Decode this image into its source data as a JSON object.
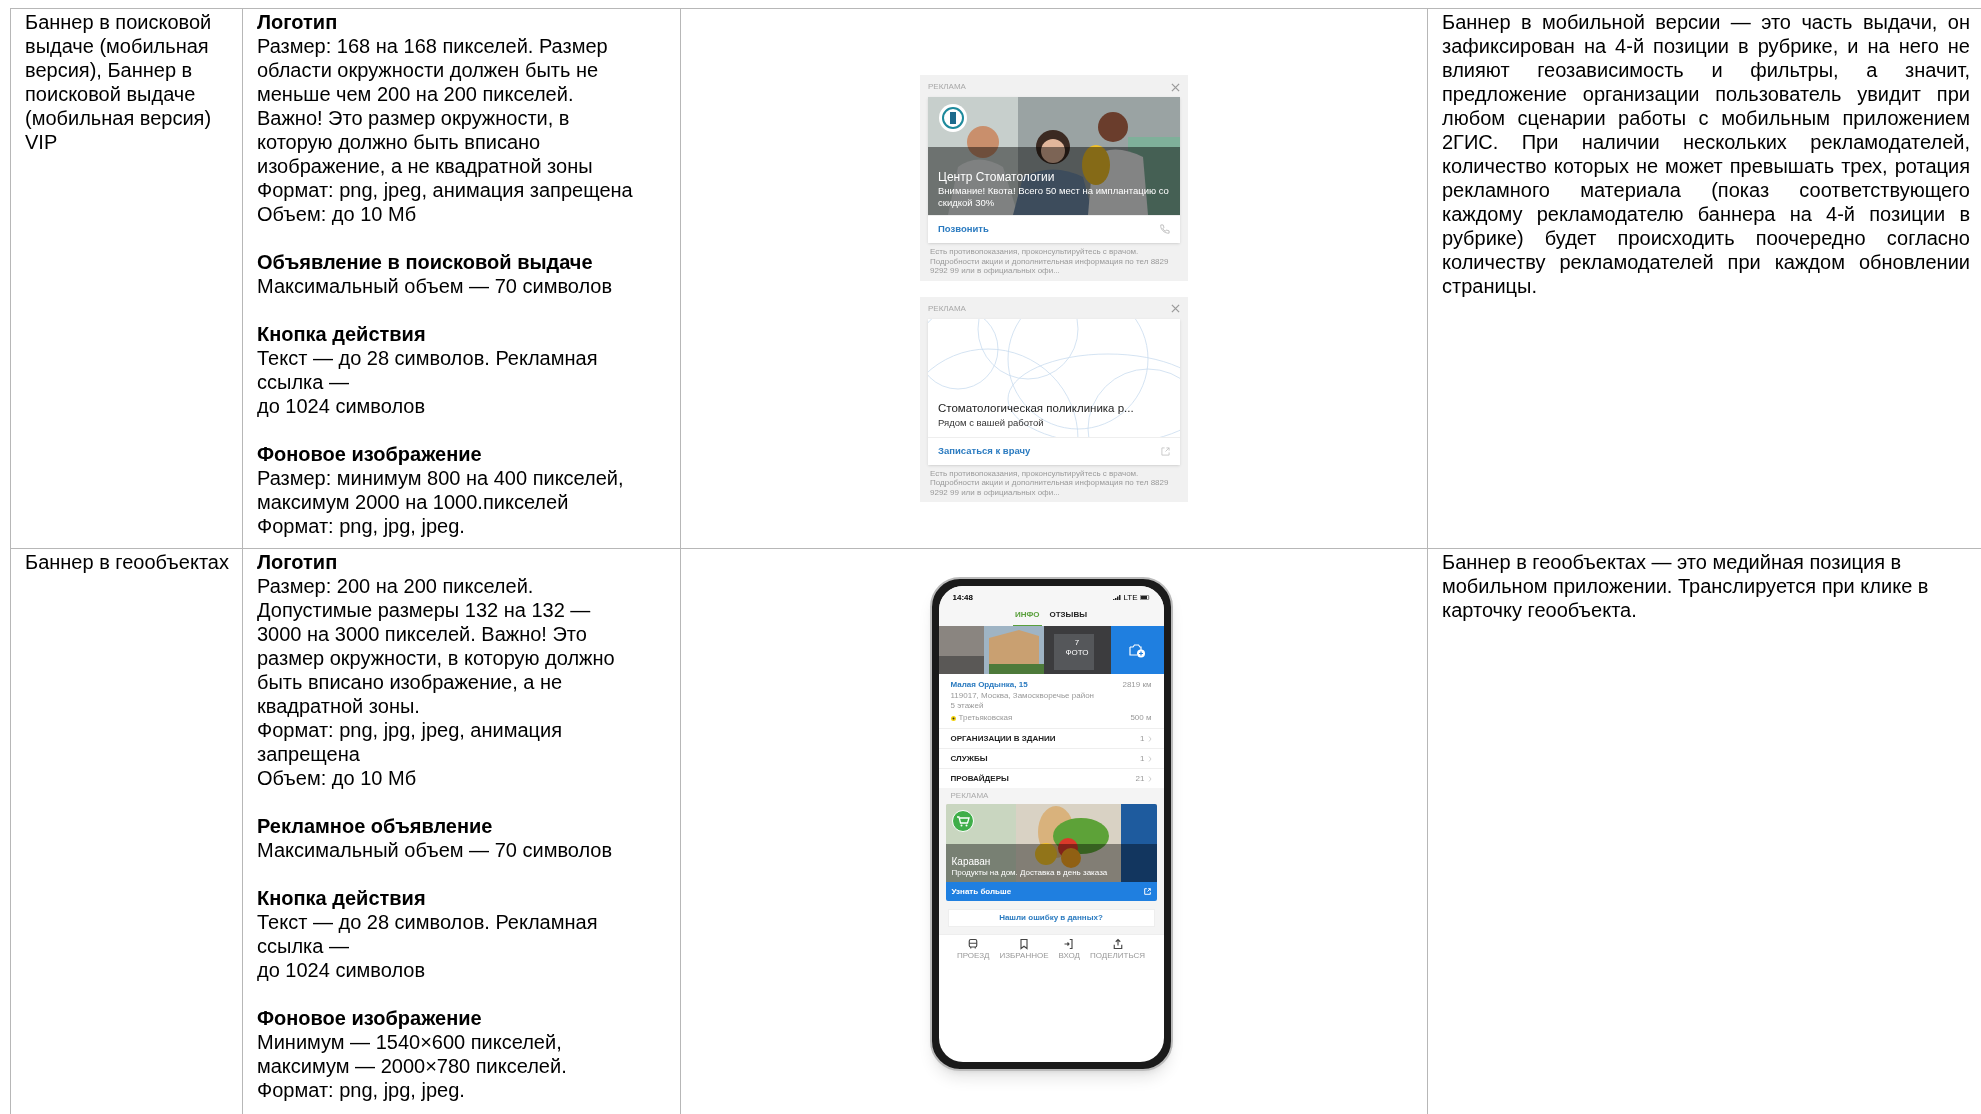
{
  "table": {
    "rows": [
      {
        "name": "Баннер в поисковой выдаче (мобильная версия), Баннер в поисковой выдаче (мобильная версия) VIP",
        "requirements": [
          {
            "heading": "Логотип",
            "lines": [
              "Размер: 168 на 168 пикселей. Размер области окружности должен быть не меньше чем 200 на 200 пикселей. Важно! Это размер окружности, в которую должно быть вписано изображение, а не квадратной зоны",
              "Формат: png, jpeg, анимация запрещена",
              "Объем: до 10 Мб"
            ]
          },
          {
            "heading": "Объявление в поисковой выдаче",
            "lines": [
              "Максимальный объем — 70 символов"
            ]
          },
          {
            "heading": "Кнопка действия",
            "lines": [
              "Текст — до 28 символов. Рекламная ссылка —",
              "до 1024 символов"
            ]
          },
          {
            "heading": "Фоновое изображение",
            "lines": [
              "Размер: минимум 800 на 400 пикселей, максимум 2000 на 1000.пикселей",
              "Формат: png, jpg, jpeg."
            ]
          }
        ],
        "preview": {
          "kind": "banners",
          "banners": [
            {
              "label": "РЕКЛАМА",
              "title": "Центр Стоматологии",
              "text": "Внимание! Квота! Всего 50 мест на имплантацию со скидкой 30%",
              "action": "Позвонить",
              "disclaimer": "Есть противопоказания, проконсультируйтесь с врачом. Подробности акции и дополнительная информация по тел 8829 9292 99 или в официальных офи..."
            },
            {
              "kind": "pattern",
              "label": "РЕКЛАМА",
              "title": "Стоматологическая поликлиника р...",
              "text": "Рядом с вашей работой",
              "action": "Записаться к врачу",
              "disclaimer": "Есть противопоказания, проконсультируйтесь с врачом. Подробности акции и дополнительная информация по тел 8829 9292 99 или в официальных офи..."
            }
          ]
        },
        "description": "Баннер в мобильной версии — это часть выдачи, он зафиксирован на 4-й позиции в рубрике, и на него не влияют геозависимость и фильтры, а значит, предложение организации пользователь увидит при любом сценарии работы с мобильным приложением 2ГИС. При наличии нескольких рекламодателей, количество которых не может превышать трех, ротация рекламного материала (показ соответствующего каждому рекламодателю баннера на 4-й позиции в рубрике) будет происходить поочередно согласно количеству рекламодателей при каждом обновлении страницы.",
        "justified": true
      },
      {
        "name": "Баннер в геообъектах",
        "requirements": [
          {
            "heading": "Логотип",
            "lines": [
              "Размер: 200 на 200 пикселей.",
              "Допустимые размеры 132 на 132 — 3000 на 3000 пикселей. Важно! Это размер окружности, в которую должно быть вписано изображение, а не квадратной зоны.",
              "Формат: png, jpg, jpeg, анимация запрещена",
              "Объем: до 10 Мб"
            ]
          },
          {
            "heading": "Рекламное объявление",
            "lines": [
              "Максимальный объем — 70 символов"
            ]
          },
          {
            "heading": "Кнопка действия",
            "lines": [
              "Текст — до 28 символов. Рекламная ссылка —",
              "до 1024 символов"
            ]
          },
          {
            "heading": "Фоновое изображение",
            "lines": [
              "Минимум — 1540×600 пикселей, максимум — 2000×780 пикселей.",
              "Формат: png, jpg, jpeg."
            ]
          }
        ],
        "preview": {
          "kind": "phone",
          "time": "14:48",
          "network": "LTE",
          "tabs": [
            {
              "label": "ИНФО",
              "selected": true
            },
            {
              "label": "ОТЗЫВЫ",
              "selected": false
            }
          ],
          "photo_count": "7",
          "photo_label": "ФОТО",
          "address": "Малая Ордынка, 15",
          "distance": "2819 км",
          "details": [
            "119017, Москва, Замоскворечье район",
            "5 этажей"
          ],
          "metro": "Третьяковская",
          "metro_distance": "500 м",
          "list": [
            {
              "label": "ОРГАНИЗАЦИИ В ЗДАНИИ",
              "count": "1"
            },
            {
              "label": "СЛУЖБЫ",
              "count": "1"
            },
            {
              "label": "ПРОВАЙДЕРЫ",
              "count": "21"
            }
          ],
          "ad_label": "РЕКЛАМА",
          "ad_title": "Караван",
          "ad_text": "Продукты на дом. Доставка в день заказа",
          "ad_action": "Узнать больше",
          "error_link": "Нашли ошибку в данных?",
          "nav": [
            {
              "kind": "bus",
              "label": "ПРОЕЗД"
            },
            {
              "kind": "bookmark",
              "label": "ИЗБРАННОЕ"
            },
            {
              "kind": "entrance",
              "label": "ВХОД"
            },
            {
              "kind": "share",
              "label": "ПОДЕЛИТЬСЯ"
            }
          ]
        },
        "description": "Баннер в геообъектах — это медийная позиция в мобильном приложении. Транслируется при клике в карточку геообъекта.",
        "justified": false
      }
    ]
  }
}
